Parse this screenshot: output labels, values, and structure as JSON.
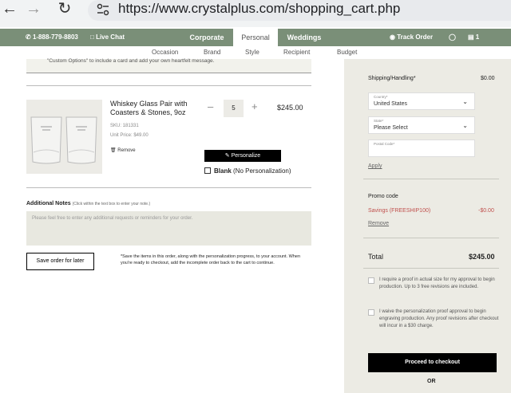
{
  "browser": {
    "url": "https://www.crystalplus.com/shopping_cart.php"
  },
  "topbar": {
    "phone": "1-888-779-8803",
    "live_chat": "Live Chat",
    "nav": [
      "Corporate",
      "Personal",
      "Weddings"
    ],
    "track_order": "Track Order",
    "cart_count": "1"
  },
  "subnav": [
    "Occasion",
    "Brand",
    "Style",
    "Recipient",
    "Budget"
  ],
  "cart": {
    "notice_text": "\"Custom Options\" to include a card and add your own heartfelt message.",
    "item": {
      "name": "Whiskey Glass Pair with Coasters & Stones, 9oz",
      "sku": "SKU: 181331",
      "unit_price": "Unit Price: $49.00",
      "remove": "Remove",
      "quantity": "5",
      "price": "$245.00",
      "personalize_button": "Personalize",
      "blank_label": "Blank",
      "blank_suffix": "(No Personalization)"
    },
    "notes": {
      "label": "Additional Notes",
      "hint": "(Click within the text box to enter your note.)",
      "placeholder": "Please feel free to enter any additional requests or reminders for your order."
    },
    "save_button": "Save order for later",
    "save_note": "*Save the items in this order, along with the personalization progress, to your account. When you're ready to checkout, add the incomplete order back to the cart to continue."
  },
  "summary": {
    "shipping_label": "Shipping/Handling*",
    "shipping_value": "$0.00",
    "country_label": "Country*",
    "country_value": "United States",
    "state_label": "State*",
    "state_value": "Please Select",
    "postal_label": "Postal Code*",
    "apply": "Apply",
    "promo_label": "Promo code",
    "promo_name": "Savings (FREESHIP100)",
    "promo_value": "-$0.00",
    "promo_remove": "Remove",
    "total_label": "Total",
    "total_value": "$245.00",
    "proof_option_1": "I require a proof in actual size for my approval to begin production. Up to 3 free revisions are included.",
    "proof_option_2": "I waive the personalization proof approval to begin engraving production. Any proof revisions after checkout will incur in a $30 charge.",
    "checkout_button": "Proceed to checkout",
    "or": "OR"
  },
  "colors": {
    "topbar": "#7a8f78",
    "sidebar": "#ecebe4",
    "promo": "#c0504d"
  }
}
